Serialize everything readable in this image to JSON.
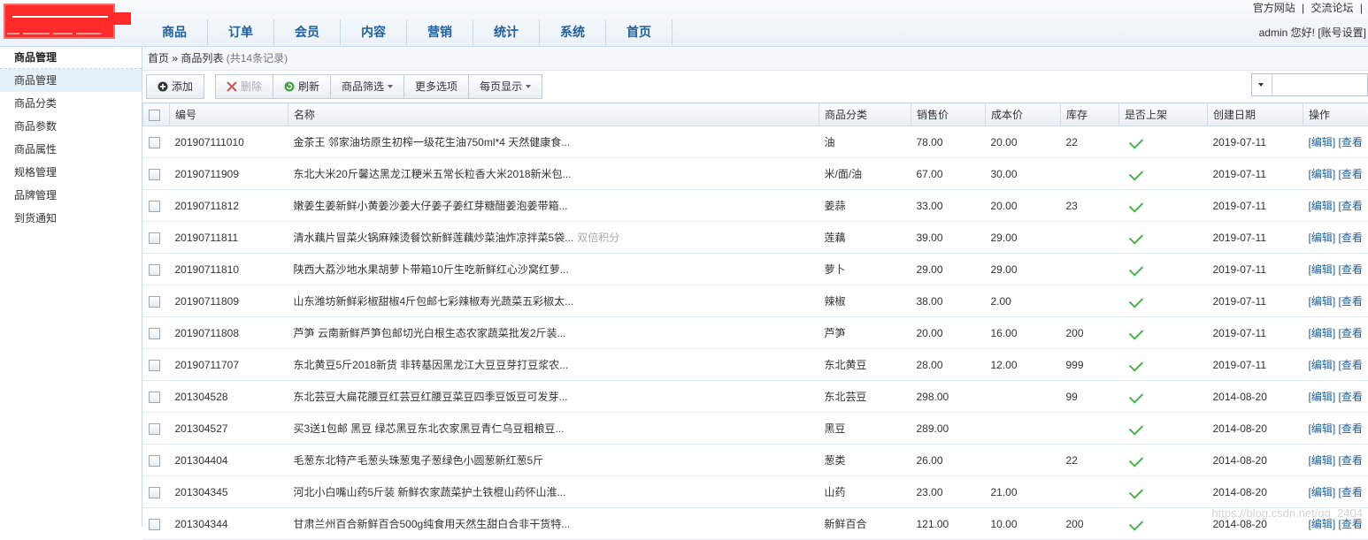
{
  "header": {
    "nav": [
      "商品",
      "订单",
      "会员",
      "内容",
      "营销",
      "统计",
      "系统",
      "首页"
    ],
    "links": [
      "官方网站",
      "|",
      "交流论坛",
      "|"
    ],
    "user": "admin 您好!",
    "account": "[账号设置]"
  },
  "sidebar": {
    "title": "商品管理",
    "items": [
      "商品管理",
      "商品分类",
      "商品参数",
      "商品属性",
      "规格管理",
      "品牌管理",
      "到货通知"
    ]
  },
  "breadcrumb": {
    "home": "首页",
    "sep": "»",
    "current": "商品列表",
    "count": "(共14条记录)"
  },
  "toolbar": {
    "add": "添加",
    "delete": "删除",
    "refresh": "刷新",
    "filter": "商品筛选",
    "more": "更多选项",
    "perpage": "每页显示"
  },
  "table": {
    "headers": [
      "编号",
      "名称",
      "商品分类",
      "销售价",
      "成本价",
      "库存",
      "是否上架",
      "创建日期",
      "操作"
    ],
    "rows": [
      {
        "id": "201907111010",
        "name": "金茶王 邻家油坊原生初榨一级花生油750ml*4 天然健康食...",
        "tag": "",
        "cat": "油",
        "price": "78.00",
        "cost": "20.00",
        "stock": "22",
        "date": "2019-07-11"
      },
      {
        "id": "20190711909",
        "name": "东北大米20斤馨达黑龙江粳米五常长粒香大米2018新米包...",
        "tag": "",
        "cat": "米/面/油",
        "price": "67.00",
        "cost": "30.00",
        "stock": "",
        "date": "2019-07-11"
      },
      {
        "id": "20190711812",
        "name": "嫩姜生姜新鲜小黄姜沙姜大仔姜子姜红芽糖醋姜泡姜带箱...",
        "tag": "",
        "cat": "姜蒜",
        "price": "33.00",
        "cost": "20.00",
        "stock": "23",
        "date": "2019-07-11"
      },
      {
        "id": "20190711811",
        "name": "清水藕片冒菜火锅麻辣烫餐饮新鲜莲藕炒菜油炸凉拌菜5袋...",
        "tag": "双倍积分",
        "cat": "莲藕",
        "price": "39.00",
        "cost": "29.00",
        "stock": "",
        "date": "2019-07-11"
      },
      {
        "id": "20190711810",
        "name": "陕西大荔沙地水果胡萝卜带箱10斤生吃新鲜红心沙窝红萝...",
        "tag": "",
        "cat": "萝卜",
        "price": "29.00",
        "cost": "29.00",
        "stock": "",
        "date": "2019-07-11"
      },
      {
        "id": "20190711809",
        "name": "山东潍坊新鲜彩椒甜椒4斤包邮七彩辣椒寿光蔬菜五彩椒太...",
        "tag": "",
        "cat": "辣椒",
        "price": "38.00",
        "cost": "2.00",
        "stock": "",
        "date": "2019-07-11"
      },
      {
        "id": "20190711808",
        "name": "芦笋 云南新鲜芦笋包邮切光白根生态农家蔬菜批发2斤装...",
        "tag": "",
        "cat": "芦笋",
        "price": "20.00",
        "cost": "16.00",
        "stock": "200",
        "date": "2019-07-11"
      },
      {
        "id": "20190711707",
        "name": "东北黄豆5斤2018新货 非转基因黑龙江大豆豆芽打豆浆农...",
        "tag": "",
        "cat": "东北黄豆",
        "price": "28.00",
        "cost": "12.00",
        "stock": "999",
        "date": "2019-07-11"
      },
      {
        "id": "201304528",
        "name": "东北芸豆大扁花腰豆红芸豆红腰豆菜豆四季豆饭豆可发芽...",
        "tag": "",
        "cat": "东北芸豆",
        "price": "298.00",
        "cost": "",
        "stock": "99",
        "date": "2014-08-20"
      },
      {
        "id": "201304527",
        "name": "买3送1包邮 黑豆 绿芯黑豆东北农家黑豆青仁乌豆粗粮豆...",
        "tag": "",
        "cat": "黑豆",
        "price": "289.00",
        "cost": "",
        "stock": "",
        "date": "2014-08-20"
      },
      {
        "id": "201304404",
        "name": "毛葱东北特产毛葱头珠葱鬼子葱绿色小圆葱新红葱5斤",
        "tag": "",
        "cat": "葱类",
        "price": "26.00",
        "cost": "",
        "stock": "22",
        "date": "2014-08-20"
      },
      {
        "id": "201304345",
        "name": "河北小白嘴山药5斤装 新鲜农家蔬菜护土铁棍山药怀山淮...",
        "tag": "",
        "cat": "山药",
        "price": "23.00",
        "cost": "21.00",
        "stock": "",
        "date": "2014-08-20"
      },
      {
        "id": "201304344",
        "name": "甘肃兰州百合新鲜百合500g纯食用天然生甜白合非干货特...",
        "tag": "",
        "cat": "新鲜百合",
        "price": "121.00",
        "cost": "10.00",
        "stock": "200",
        "date": "2014-08-20"
      }
    ],
    "edit": "[编辑]",
    "view": "[查看"
  },
  "watermark": "https://blog.csdn.net/qq_2404"
}
